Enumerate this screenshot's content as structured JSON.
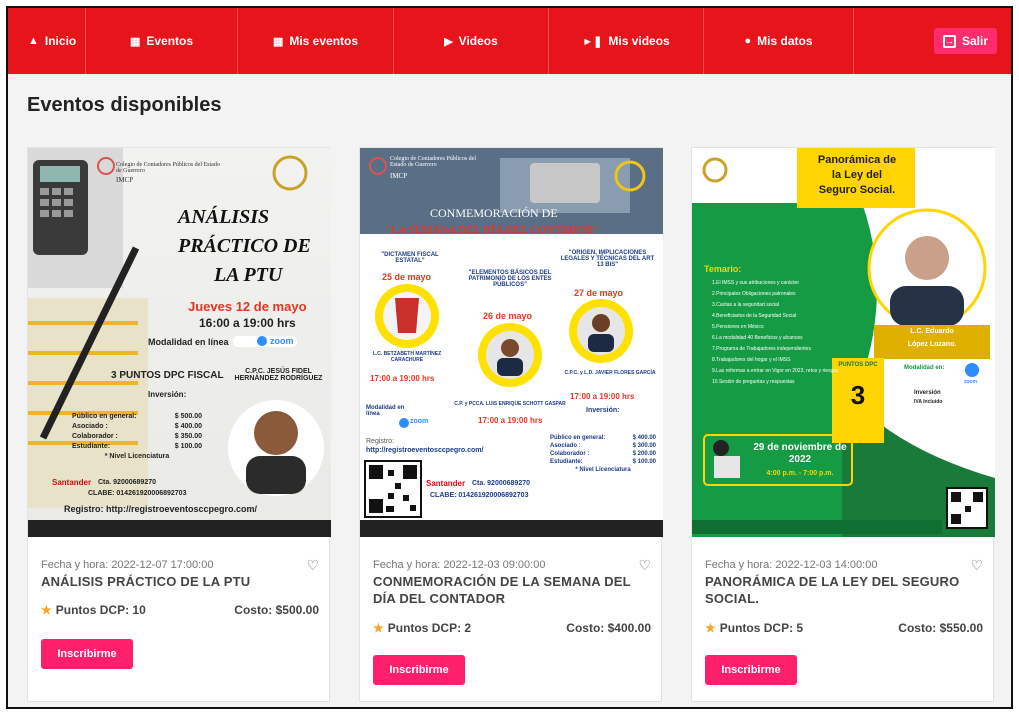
{
  "nav": {
    "inicio": "Inicio",
    "eventos": "Eventos",
    "mis_eventos": "Mis eventos",
    "videos": "Videos",
    "mis_videos": "Mis videos",
    "mis_datos": "Mis datos",
    "salir": "Salir"
  },
  "page_title": "Eventos disponibles",
  "colors": {
    "nav": "#e8141b",
    "button": "#ff1f6b",
    "star": "#f5a623"
  },
  "events": [
    {
      "date": "Fecha y hora: 2022-12-07 17:00:00",
      "title": "ANÁLISIS PRÁCTICO DE LA PTU",
      "points": "Puntos DCP: 10",
      "cost": "Costo: $500.00",
      "button": "Inscribirme",
      "poster": {
        "org": "Colegio de Contadores Públicos del Estado de Guerrero",
        "org_short": "IMCP",
        "title1": "ANÁLISIS",
        "title2": "PRÁCTICO DE",
        "title3": "LA PTU",
        "date": "Jueves 12 de mayo",
        "time": "16:00 a 19:00 hrs",
        "mode": "Modalidad en línea",
        "zoom": "zoom",
        "points": "3 PUNTOS DPC FISCAL",
        "speaker": "C.P.C. JESÚS FIDEL HERNÁNDEZ RODRÍGUEZ",
        "inversion": "Inversión:",
        "prices": [
          [
            "Público en general:",
            "$ 500.00"
          ],
          [
            "Asociado :",
            "$ 400.00"
          ],
          [
            "Colaborador :",
            "$ 350.00"
          ],
          [
            "Estudiante:",
            "$ 100.00"
          ]
        ],
        "nivel": "* Nivel Licenciatura",
        "bank": "Santander",
        "cta": "Cta. 92000689270",
        "clabe": "CLABE: 014261920006892703",
        "registro": "Registro: http://registroeventosccpegro.com/"
      }
    },
    {
      "date": "Fecha y hora: 2022-12-03 09:00:00",
      "title": "CONMEMORACIÓN DE LA SEMANA DEL DÍA DEL CONTADOR",
      "points": "Puntos DCP: 2",
      "cost": "Costo: $400.00",
      "button": "Inscribirme",
      "poster": {
        "org": "Colegio de Contadores Públicos del Estado de Guerrero",
        "org_short": "IMCP",
        "title1": "CONMEMORACIÓN DE",
        "title2": "\"LA SEMANA DEL DÍA DEL CONTADOR\"",
        "talk1": "\"DICTAMEN FISCAL ESTATAL\"",
        "day1": "25 de mayo",
        "talk2": "\"ELEMENTOS BÁSICOS DEL PATRIMONIO DE LOS ENTES PÚBLICOS\"",
        "day2": "26 de mayo",
        "talk3": "\"ORIGEN, IMPLICACIONES LEGALES Y TÉCNICAS DEL ART 13 BIS\"",
        "day3": "27 de mayo",
        "sp1": "L.C. BETZABETH MARTÍNEZ CARACHURE",
        "sp3": "C.P.C. y L.D. JAVIER FLORES GARCÍA",
        "time": "17:00 a 19:00 hrs",
        "sp2": "C.P. y PCCA. LUIS ENRIQUE SCHOTT GASPAR",
        "mode": "Modalidad en línea",
        "zoom": "zoom",
        "inversion": "Inversión:",
        "prices": [
          [
            "Público en general:",
            "$ 400.00"
          ],
          [
            "Asociado :",
            "$ 300.00"
          ],
          [
            "Colaborador :",
            "$ 200.00"
          ],
          [
            "Estudiante:",
            "$ 100.00"
          ]
        ],
        "nivel": "* Nivel Licenciatura",
        "registro": "Registro:",
        "url": "http://registroeventosccpegro.com/",
        "bank": "Santander",
        "cta": "Cta. 92000689270",
        "clabe": "CLABE: 014261920006892703"
      }
    },
    {
      "date": "Fecha y hora: 2022-12-03 14:00:00",
      "title": "PANORÁMICA DE LA LEY DEL SEGURO SOCIAL.",
      "points": "Puntos DCP: 5",
      "cost": "Costo: $550.00",
      "button": "Inscribirme",
      "poster": {
        "title1": "Panorámica de",
        "title2": "la Ley del",
        "title3": "Seguro Social.",
        "temario": "Temario:",
        "topics": [
          "1.El IMSS y sus atribuciones y carácter",
          "2.Principales Obligaciones patronales",
          "3.Cuotas a la seguridad social",
          "4.Beneficiarios de la Seguridad Social",
          "5.Pensiones en México",
          "6.La modalidad 40 Beneficios y alcances",
          "7.Programa de Trabajadores independientes",
          "8.Trabajadores del hogar y el IMSS",
          "9.Las reformas a entrar en Vigor en 2023, retos y riesgos",
          "10.Sesión de preguntas y respuestas"
        ],
        "speaker1": "L.C. Eduardo",
        "speaker2": "López Lozano.",
        "puntos": "PUNTOS DPC",
        "puntos_num": "3",
        "modalidad": "Modalidad en:",
        "zoom": "zoom",
        "inversion": "Inversión",
        "iva": "IVA Incluido",
        "date": "29 de noviembre de 2022",
        "time": "4:00 p.m. - 7:00 p.m."
      }
    }
  ]
}
